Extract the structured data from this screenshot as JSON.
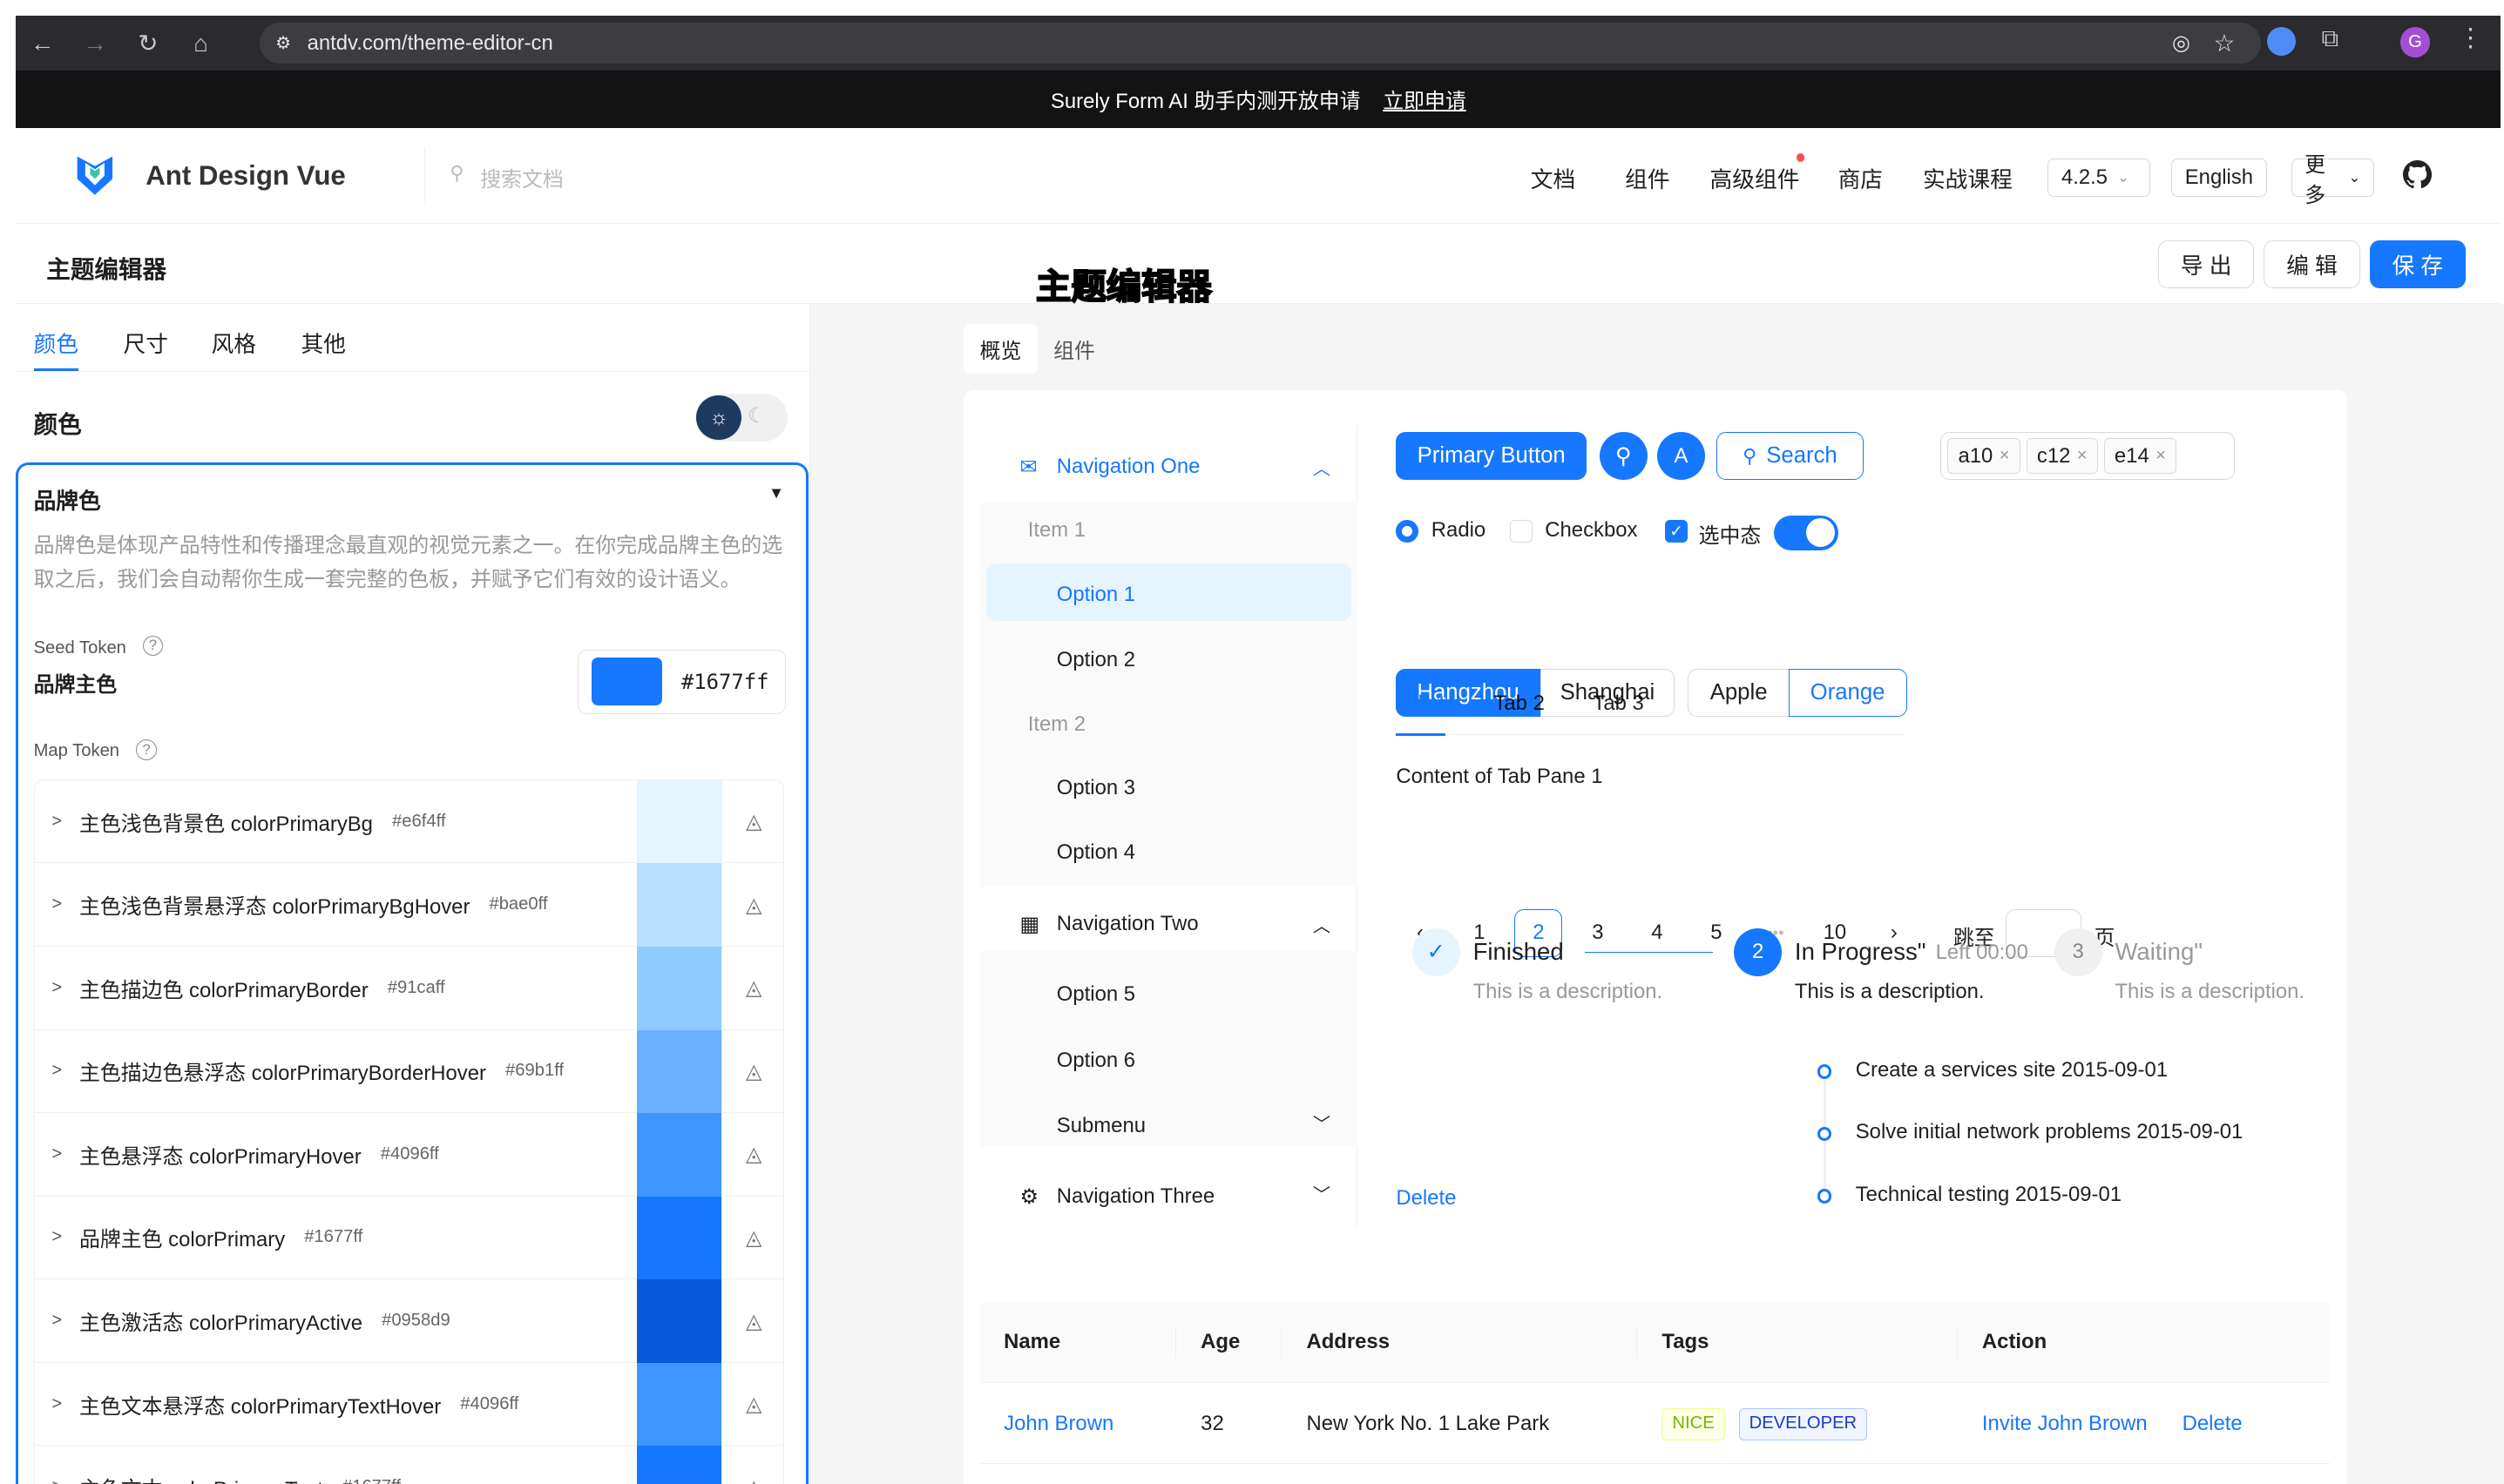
{
  "browser": {
    "url": "antdv.com/theme-editor-cn",
    "profile_initial": "G"
  },
  "banner": {
    "text": "Surely Form AI 助手内测开放申请",
    "link": "立即申请"
  },
  "header": {
    "logo_text": "Ant Design Vue",
    "search_placeholder": "搜索文档",
    "nav": [
      "文档",
      "组件",
      "高级组件",
      "商店",
      "实战课程"
    ],
    "version": "4.2.5",
    "language": "English",
    "more": "更多"
  },
  "editor": {
    "title": "主题编辑器",
    "watermark": "主题编辑器",
    "export": "导 出",
    "edit": "编 辑",
    "save": "保 存"
  },
  "left": {
    "tabs": [
      "颜色",
      "尺寸",
      "风格",
      "其他"
    ],
    "section_title": "颜色",
    "group_title": "品牌色",
    "group_desc": "品牌色是体现产品特性和传播理念最直观的视觉元素之一。在你完成品牌主色的选取之后，我们会自动帮你生成一套完整的色板，并赋予它们有效的设计语义。",
    "seed_label": "Seed Token",
    "seed_name": "品牌主色",
    "seed_value": "#1677ff",
    "map_label": "Map Token",
    "tokens": [
      {
        "name": "主色浅色背景色 colorPrimaryBg",
        "hex": "#e6f4ff",
        "color": "#e6f4ff"
      },
      {
        "name": "主色浅色背景悬浮态 colorPrimaryBgHover",
        "hex": "#bae0ff",
        "color": "#bae0ff"
      },
      {
        "name": "主色描边色 colorPrimaryBorder",
        "hex": "#91caff",
        "color": "#91caff"
      },
      {
        "name": "主色描边色悬浮态 colorPrimaryBorderHover",
        "hex": "#69b1ff",
        "color": "#69b1ff"
      },
      {
        "name": "主色悬浮态 colorPrimaryHover",
        "hex": "#4096ff",
        "color": "#4096ff"
      },
      {
        "name": "品牌主色 colorPrimary",
        "hex": "#1677ff",
        "color": "#1677ff"
      },
      {
        "name": "主色激活态 colorPrimaryActive",
        "hex": "#0958d9",
        "color": "#0958d9"
      },
      {
        "name": "主色文本悬浮态 colorPrimaryTextHover",
        "hex": "#4096ff",
        "color": "#4096ff"
      },
      {
        "name": "主色文本 colorPrimaryText",
        "hex": "#1677ff",
        "color": "#1677ff"
      }
    ]
  },
  "preview": {
    "tabs": [
      "概览",
      "组件"
    ],
    "menu": {
      "nav1": "Navigation One",
      "item1": "Item 1",
      "opt1": "Option 1",
      "opt2": "Option 2",
      "item2": "Item 2",
      "opt3": "Option 3",
      "opt4": "Option 4",
      "nav2": "Navigation Two",
      "opt5": "Option 5",
      "opt6": "Option 6",
      "submenu": "Submenu",
      "nav3": "Navigation Three"
    },
    "primary_button": "Primary Button",
    "avatar": "A",
    "search_button": "Search",
    "select_tags": [
      "a10",
      "c12",
      "e14"
    ],
    "radio": "Radio",
    "checkbox": "Checkbox",
    "checked": "选中态",
    "radio_buttons": [
      "Hangzhou",
      "Shanghai",
      "Apple",
      "Orange"
    ],
    "tabs2": [
      "Tab 1",
      "Tab 2",
      "Tab 3"
    ],
    "tab_content": "Content of Tab Pane 1",
    "pagination": [
      "1",
      "2",
      "3",
      "4",
      "5",
      "•••",
      "10"
    ],
    "jump_label": "跳至",
    "page_label": "页",
    "steps": [
      {
        "title": "Finished",
        "desc": "This is a description."
      },
      {
        "num": "2",
        "title": "In Progress\"",
        "extra": "Left 00:00",
        "desc": "This is a description."
      },
      {
        "num": "3",
        "title": "Waiting\"",
        "desc": "This is a description."
      }
    ],
    "timeline": [
      "Create a services site 2015-09-01",
      "Solve initial network problems 2015-09-01",
      "Technical testing 2015-09-01"
    ],
    "delete_link": "Delete",
    "table": {
      "headers": [
        "Name",
        "Age",
        "Address",
        "Tags",
        "Action"
      ],
      "row": {
        "name": "John Brown",
        "age": "32",
        "address": "New York No. 1 Lake Park",
        "tags": [
          "NICE",
          "DEVELOPER"
        ],
        "invite": "Invite John Brown",
        "delete": "Delete"
      }
    }
  }
}
